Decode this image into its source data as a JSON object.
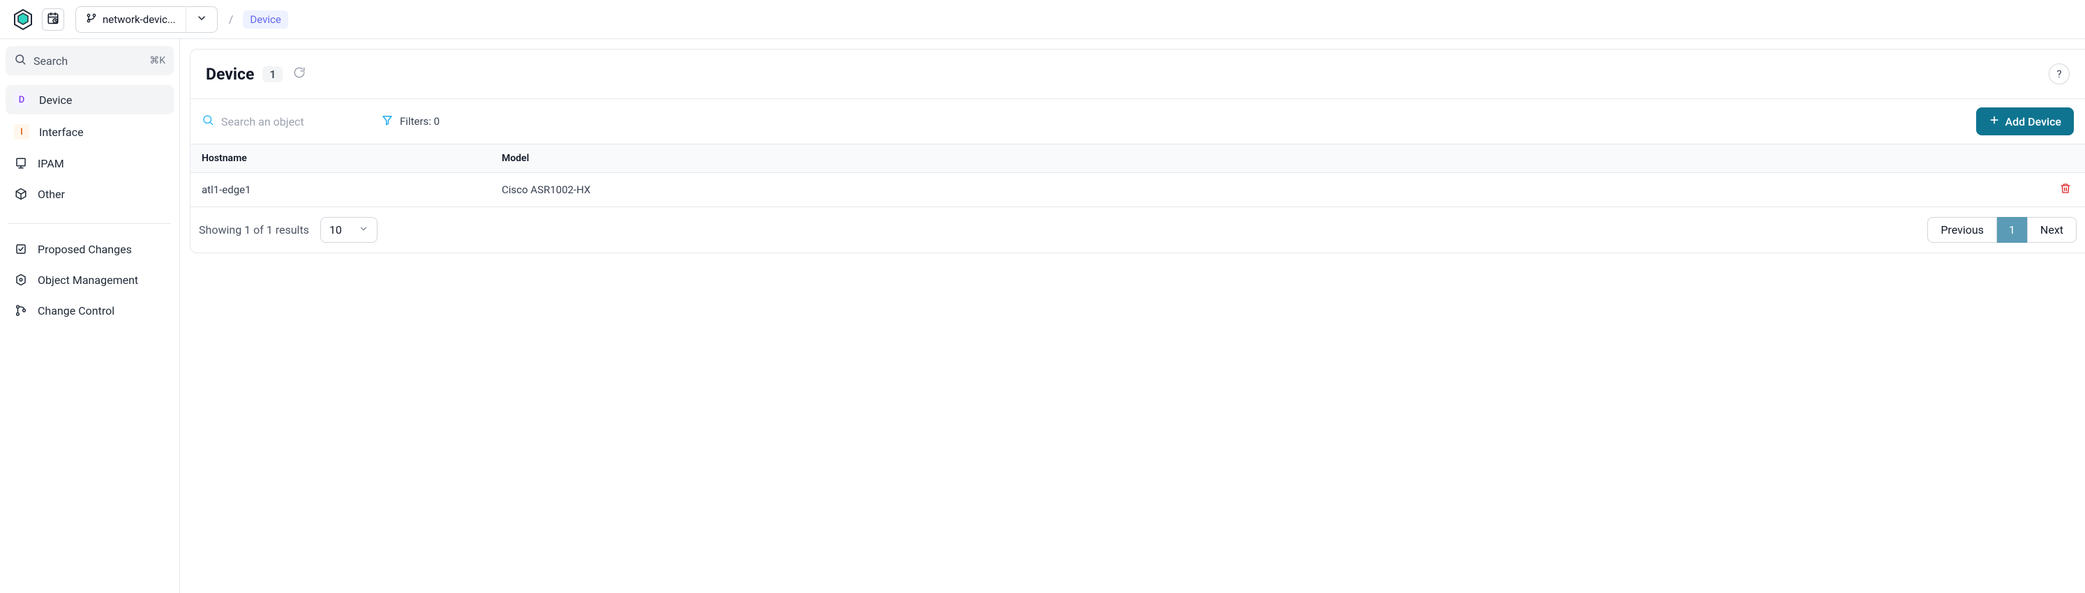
{
  "topbar": {
    "branch_name": "network-devic...",
    "breadcrumb_sep": "/",
    "breadcrumb_current": "Device"
  },
  "sidebar": {
    "search_label": "Search",
    "search_shortcut": "⌘K",
    "items": [
      {
        "label": "Device",
        "icon_letter": "D"
      },
      {
        "label": "Interface",
        "icon_letter": "I"
      },
      {
        "label": "IPAM"
      },
      {
        "label": "Other"
      }
    ],
    "lower_items": [
      {
        "label": "Proposed Changes"
      },
      {
        "label": "Object Management"
      },
      {
        "label": "Change Control"
      }
    ]
  },
  "page": {
    "title": "Device",
    "count": "1",
    "help_label": "?",
    "search_placeholder": "Search an object",
    "filters_label": "Filters: 0",
    "add_button": "Add Device"
  },
  "table": {
    "columns": [
      {
        "key": "hostname",
        "label": "Hostname"
      },
      {
        "key": "model",
        "label": "Model"
      }
    ],
    "rows": [
      {
        "hostname": "atl1-edge1",
        "model": "Cisco ASR1002-HX"
      }
    ]
  },
  "footer": {
    "results_text": "Showing 1 of 1 results",
    "page_size": "10",
    "previous": "Previous",
    "current_page": "1",
    "next": "Next"
  }
}
